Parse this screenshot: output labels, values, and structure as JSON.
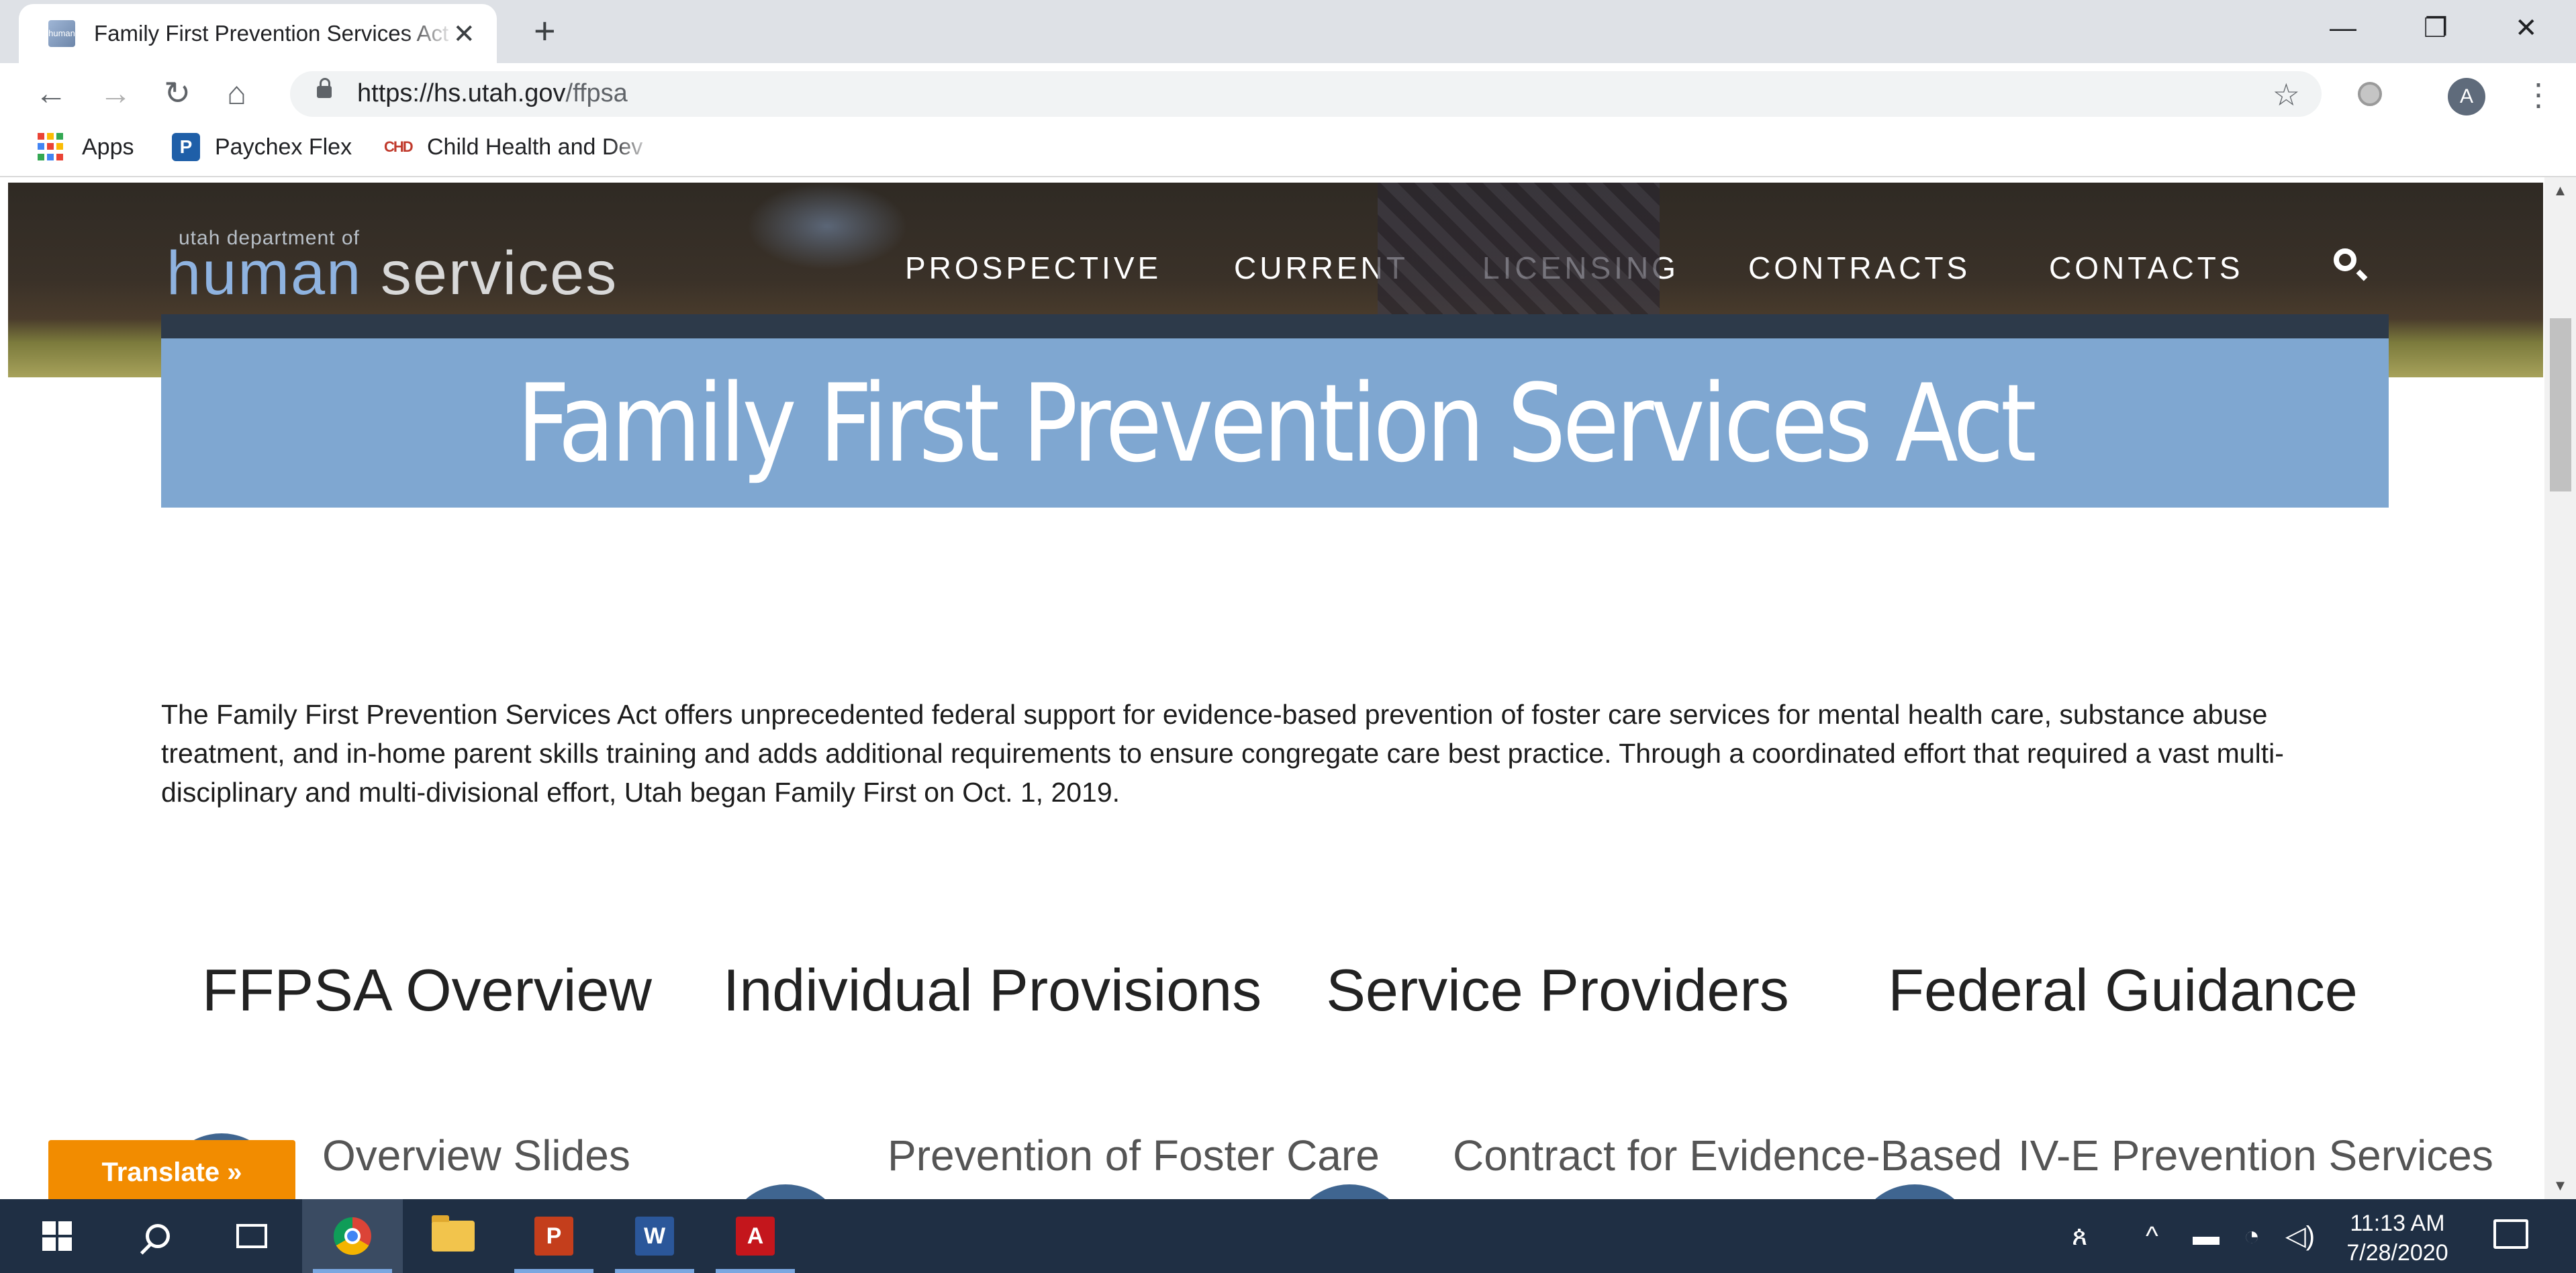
{
  "browser": {
    "tab_title": "Family First Prevention Services Act - Utah Department of Human Services",
    "new_tab_symbol": "+",
    "close_tab_symbol": "✕",
    "favicon_text": "human service",
    "window_controls": {
      "minimize": "—",
      "restore": "❐",
      "close": "✕"
    },
    "nav": {
      "back": "←",
      "forward": "→",
      "reload": "↻",
      "home": "⌂"
    },
    "url_host": "https://hs.utah.gov",
    "url_path": "/ffpsa",
    "star_symbol": "☆",
    "profile_initial": "A",
    "menu_symbol": "⋮",
    "bookmarks": [
      {
        "label": "Apps"
      },
      {
        "label": "Paychex Flex",
        "icon_text": "P"
      },
      {
        "label": "Child Health and Dev",
        "icon_text": "CHD"
      }
    ]
  },
  "site": {
    "logo_small": "utah department of",
    "logo_human": "human",
    "logo_services": "services",
    "nav": [
      "PROSPECTIVE",
      "CURRENT",
      "LICENSING",
      "CONTRACTS",
      "CONTACTS"
    ],
    "search_icon": "search-icon"
  },
  "page": {
    "title": "Family First Prevention Services Act",
    "intro": "The Family First Prevention Services Act offers unprecedented federal support for evidence-based prevention of foster care services for mental health care, substance abuse treatment, and in-home parent skills training and adds additional requirements to ensure congregate care best practice. Through a coordinated effort that required a vast multi-disciplinary and multi-divisional effort, Utah began Family First on Oct. 1, 2019.",
    "columns": [
      {
        "title": "FFPSA Overview",
        "link": "Overview Slides"
      },
      {
        "title": "Individual Provisions",
        "link": "Prevention of Foster Care"
      },
      {
        "title": "Service Providers",
        "link": "Contract for Evidence-Based"
      },
      {
        "title": "Federal Guidance",
        "link": "IV-E Prevention Services"
      }
    ],
    "translate_button": "Translate »"
  },
  "scrollbar": {
    "up": "▲",
    "down": "▼"
  },
  "taskbar": {
    "apps": [
      "start",
      "search",
      "task-view",
      "chrome",
      "file-explorer",
      "powerpoint",
      "word",
      "acrobat"
    ],
    "powerpoint_letter": "P",
    "word_letter": "W",
    "acrobat_letter": "A",
    "time": "11:13 AM",
    "date": "7/28/2020"
  },
  "colors": {
    "banner": "#7fa7d1",
    "translate": "#f28c00",
    "taskbar": "#1f2f44",
    "logo_human": "#8fb3e0"
  }
}
